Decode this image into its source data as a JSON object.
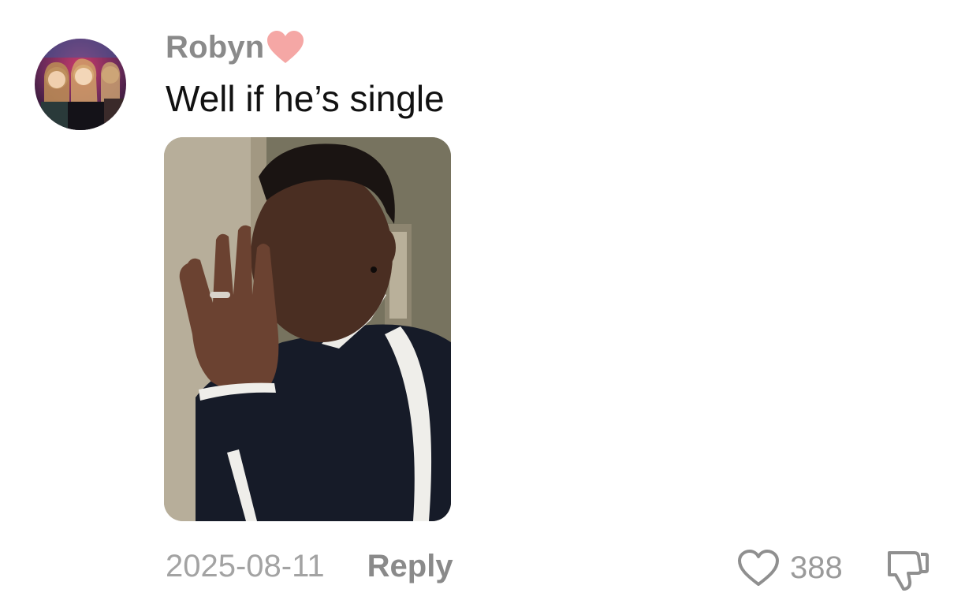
{
  "comment": {
    "author": "Robyn",
    "author_badge_icon": "heart-icon",
    "badge_color": "#f4a3a3",
    "text": "Well if he’s single",
    "date": "2025-08-11",
    "reply_label": "Reply",
    "like_count": "388",
    "like_icon": "heart-outline-icon",
    "dislike_icon": "thumbs-down-icon"
  }
}
